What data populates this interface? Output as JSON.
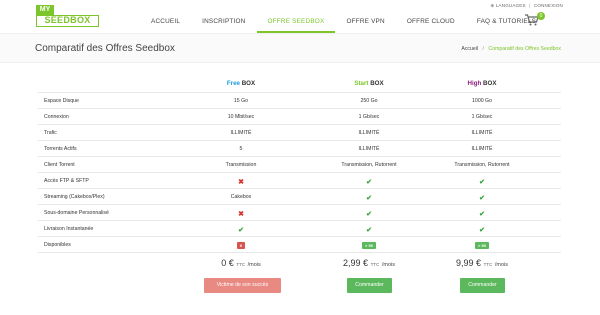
{
  "logo": {
    "my": "MY",
    "seedbox": "SEEDBOX"
  },
  "topright": {
    "languages": "LANGUAGES",
    "connexion": "CONNEXION"
  },
  "nav": [
    "ACCUEIL",
    "INSCRIPTION",
    "OFFRE SEEDBOX",
    "OFFRE VPN",
    "OFFRE CLOUD",
    "FAQ & TUTORIELS"
  ],
  "cart": {
    "count": "0"
  },
  "page": {
    "title": "Comparatif des Offres Seedbox"
  },
  "breadcrumb": {
    "home": "Accueil",
    "current": "Comparatif des Offres Seedbox"
  },
  "plans": [
    {
      "name": "Free",
      "suffix": "BOX"
    },
    {
      "name": "Start",
      "suffix": "BOX"
    },
    {
      "name": "High",
      "suffix": "BOX"
    }
  ],
  "rows": [
    {
      "label": "Espace Disque",
      "values": [
        "15 Go",
        "250 Go",
        "1000 Go"
      ]
    },
    {
      "label": "Connexion",
      "values": [
        "10 Mbit/sec",
        "1 Gb/sec",
        "1 Gb/sec"
      ]
    },
    {
      "label": "Trafic",
      "values": [
        "ILLIMITÉ",
        "ILLIMITÉ",
        "ILLIMITÉ"
      ]
    },
    {
      "label": "Torrents Actifs",
      "values": [
        "5",
        "ILLIMITÉ",
        "ILLIMITÉ"
      ]
    },
    {
      "label": "Client Torrent",
      "values": [
        "Transmission",
        "Transmission, Rutorrent",
        "Transmission, Rutorrent"
      ]
    },
    {
      "label": "Accès FTP & SFTP",
      "values": [
        "✖",
        "✔",
        "✔"
      ]
    },
    {
      "label": "Streaming (Cakebox/Plex)",
      "values": [
        "Cakebox",
        "✔",
        "✔"
      ]
    },
    {
      "label": "Sous-domaine Personnalisé",
      "values": [
        "✖",
        "✔",
        "✔"
      ]
    },
    {
      "label": "Livraison Instantanée",
      "values": [
        "✔",
        "✔",
        "✔"
      ]
    },
    {
      "label": "Disponibles",
      "values": [
        "0",
        "> 50",
        "> 50"
      ]
    }
  ],
  "prices": [
    {
      "amount": "0 €",
      "ttc": "TTC",
      "per": "/mois"
    },
    {
      "amount": "2,99 €",
      "ttc": "TTC",
      "per": "/mois"
    },
    {
      "amount": "9,99 €",
      "ttc": "TTC",
      "per": "/mois"
    }
  ],
  "buttons": {
    "victim": "Victime de son succès",
    "order1": "Commander",
    "order2": "Commander"
  },
  "colors": {
    "accent": "#7cc52a",
    "free": "#1a9be0",
    "high": "#8a1c7c",
    "check": "#3fa33f",
    "cross": "#d9362f"
  }
}
